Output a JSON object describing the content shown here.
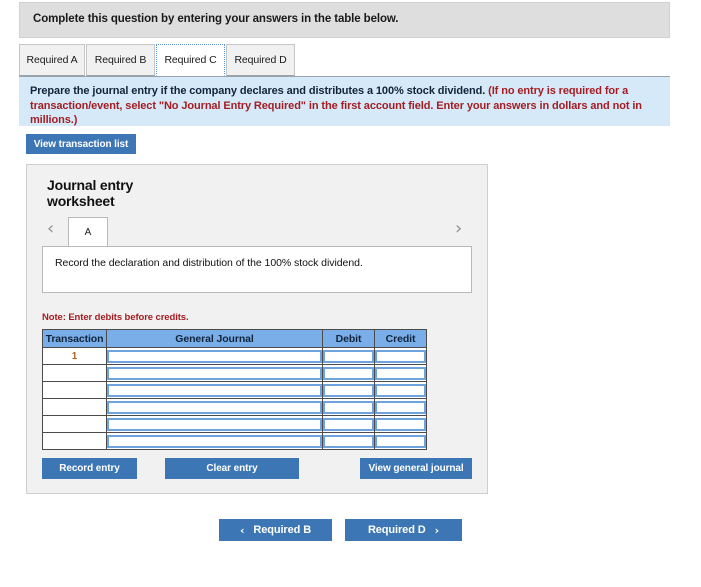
{
  "banner": {
    "text": "Complete this question by entering your answers in the table below."
  },
  "tabs": [
    {
      "label": "Required A",
      "active": false
    },
    {
      "label": "Required B",
      "active": false
    },
    {
      "label": "Required C",
      "active": true
    },
    {
      "label": "Required D",
      "active": false
    }
  ],
  "instruction": {
    "main": "Prepare the journal entry if the company declares and distributes a 100% stock dividend.",
    "hint": "(If no entry is required for a transaction/event, select \"No Journal Entry Required\" in the first account field. Enter your answers in dollars and not in millions.)"
  },
  "toolbar": {
    "view_transaction_list_label": "View transaction list"
  },
  "worksheet": {
    "title_line1": "Journal entry",
    "title_line2": "worksheet",
    "prev_arrow": "‹",
    "next_arrow": "›",
    "entry_tab_label": "A",
    "entry_description": "Record the declaration and distribution of the 100% stock dividend.",
    "note": "Note:  Enter debits before credits.",
    "table": {
      "headers": [
        "Transaction",
        "General Journal",
        "Debit",
        "Credit"
      ],
      "rows": [
        {
          "transaction": "1",
          "general_journal": "",
          "debit": "",
          "credit": ""
        },
        {
          "transaction": "",
          "general_journal": "",
          "debit": "",
          "credit": ""
        },
        {
          "transaction": "",
          "general_journal": "",
          "debit": "",
          "credit": ""
        },
        {
          "transaction": "",
          "general_journal": "",
          "debit": "",
          "credit": ""
        },
        {
          "transaction": "",
          "general_journal": "",
          "debit": "",
          "credit": ""
        },
        {
          "transaction": "",
          "general_journal": "",
          "debit": "",
          "credit": ""
        }
      ]
    },
    "actions": {
      "record_entry_label": "Record entry",
      "clear_entry_label": "Clear entry",
      "view_general_journal_label": "View general journal"
    }
  },
  "pager": {
    "prev_label": "Required B",
    "next_label": "Required D",
    "prev_chevron": "‹",
    "next_chevron": "›"
  },
  "colors": {
    "button_blue": "#3c76b4",
    "table_header_blue": "#79aee8",
    "instruction_blue": "#d6e9f8",
    "banner_gray": "#dedede",
    "hint_red": "#a51d22",
    "transaction_number": "#b5651d"
  }
}
